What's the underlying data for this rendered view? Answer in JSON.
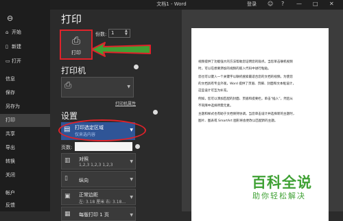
{
  "titlebar": {
    "title": "文档1 - Word",
    "login": "登录",
    "smiley": "☺",
    "help": "?",
    "minimize": "—",
    "maximize": "□",
    "close": "✕"
  },
  "sidebar": {
    "back_icon": "back-arrow-icon",
    "items": [
      {
        "label": "开始",
        "icon": "home-icon"
      },
      {
        "label": "新建",
        "icon": "new-doc-icon"
      },
      {
        "label": "打开",
        "icon": "folder-icon"
      },
      {
        "label": "信息",
        "icon": ""
      },
      {
        "label": "保存",
        "icon": ""
      },
      {
        "label": "另存为",
        "icon": ""
      },
      {
        "label": "打印",
        "icon": "",
        "active": true
      },
      {
        "label": "共享",
        "icon": ""
      },
      {
        "label": "导出",
        "icon": ""
      },
      {
        "label": "转换",
        "icon": ""
      },
      {
        "label": "关闭",
        "icon": ""
      },
      {
        "label": "帐户",
        "icon": ""
      },
      {
        "label": "反馈",
        "icon": ""
      }
    ]
  },
  "main": {
    "title": "打印",
    "print_button_label": "打印",
    "copies_label": "份数:",
    "copies_value": "1",
    "printer_section": "打印机",
    "printer_properties": "打印机属性",
    "settings_section": "设置",
    "print_range": {
      "title": "打印选定区域",
      "subtitle": "仅来选内容"
    },
    "pages_label": "页数:",
    "pages_value": "",
    "options": [
      {
        "title": "对照",
        "subtitle": "1,2,3    1,2,3    1,2,3",
        "icon": "collate-icon"
      },
      {
        "title": "纵向",
        "subtitle": "",
        "icon": "portrait-icon"
      },
      {
        "title": "正常边距",
        "subtitle": "左: 3.18 厘米    右: 3.18...",
        "icon": "margins-icon"
      },
      {
        "title": "每版打印 1 页",
        "subtitle": "",
        "icon": "pages-per-sheet-icon"
      }
    ]
  },
  "preview": {
    "lines": [
      "视频提供了功能强大的方法帮助您证明您的观点。当您单击联机视频",
      "时，可以在想要添加的视频的嵌入代码中进行粘贴。",
      "您也可以键入一个关键字以联机搜索最适合您的文档的视频。为使您",
      "的文档具有专业外观，Word 提供了页眉、页脚、封面和文本框设计，",
      "这些设计可互为补充。",
      "例如，您可以添加匹配的封面、页眉和提要栏。单击“插入”，然后从",
      "不同库中选择所需元素。",
      "主题和样式也有助于文档保持协调。当您单击设计并选择新的主题时，",
      "图片、图表或 SmartArt 图形将会更改以匹配新的主题。"
    ]
  },
  "watermark": {
    "title": "百科全说",
    "subtitle": "助你轻松解决"
  },
  "colors": {
    "accent": "#2f5597",
    "annotation_red": "#e0222a",
    "annotation_green": "#3fa134"
  }
}
